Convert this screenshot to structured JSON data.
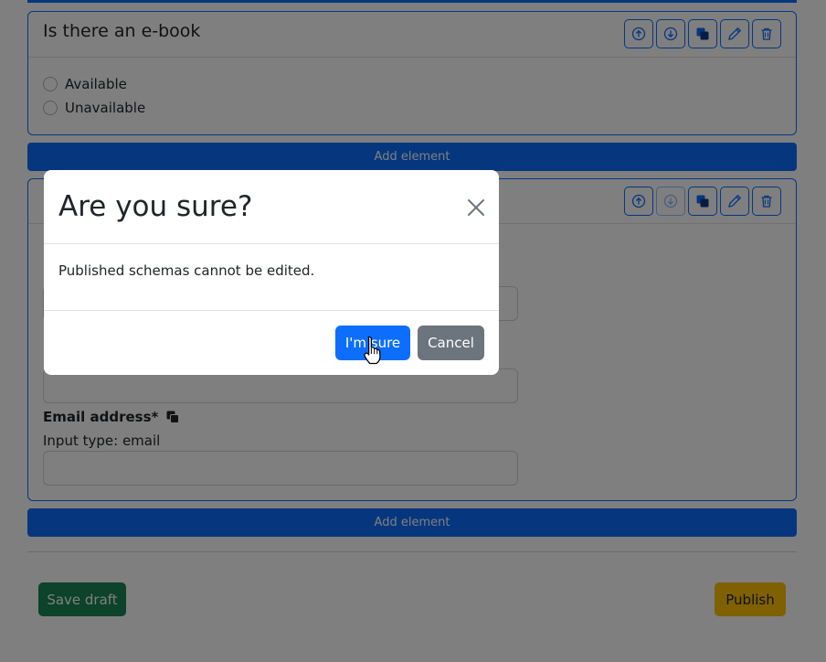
{
  "card1": {
    "title": "Is there an e-book",
    "options": [
      "Available",
      "Unavailable"
    ]
  },
  "add_element_label": "Add element",
  "card2": {
    "fields": [
      {
        "label": "Email address*",
        "sub": "Input type: email"
      }
    ]
  },
  "icons": [
    "arrow-up-icon",
    "arrow-down-icon",
    "copy-icon",
    "pencil-icon",
    "trash-icon"
  ],
  "footer": {
    "save_draft": "Save draft",
    "publish": "Publish"
  },
  "modal": {
    "title": "Are you sure?",
    "body": "Published schemas cannot be edited.",
    "confirm": "I'm sure",
    "cancel": "Cancel"
  },
  "colors": {
    "primary": "#0d6efd",
    "success": "#198754",
    "warning": "#ffc107",
    "secondary": "#6c757d"
  }
}
